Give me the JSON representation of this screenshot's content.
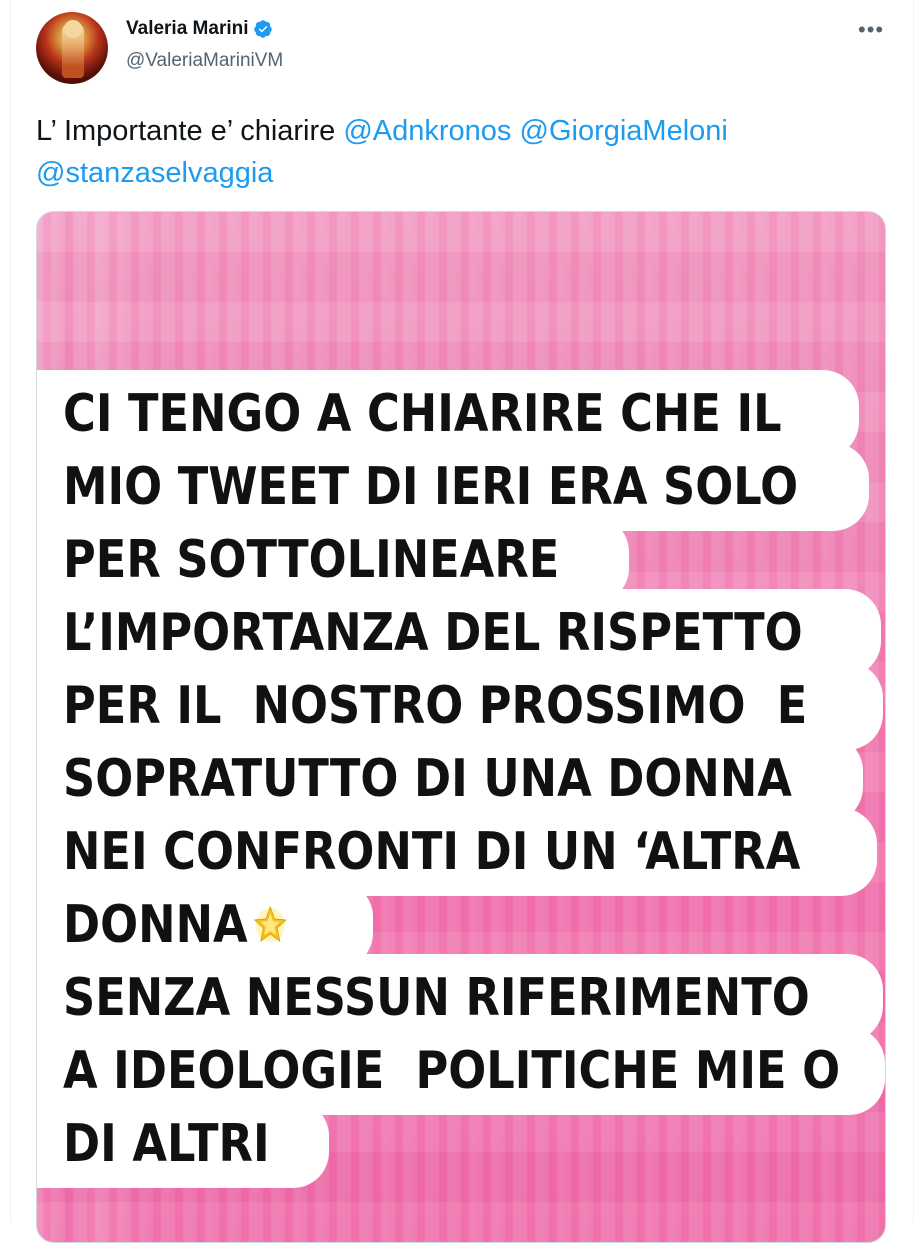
{
  "author": {
    "display_name": "Valeria Marini",
    "handle": "@ValeriaMariniVM",
    "verified": true,
    "avatar_icon": "profile-photo-icon"
  },
  "actions": {
    "more_label": "•••"
  },
  "tweet": {
    "text_prefix": "L’ Importante e’ chiarire ",
    "mentions": [
      "@Adnkronos",
      "@GiorgiaMeloni",
      "@stanzaselvaggia"
    ]
  },
  "media": {
    "lines": [
      "CI TENGO A CHIARIRE CHE IL",
      "MIO TWEET DI IERI ERA SOLO",
      "PER SOTTOLINEARE",
      "L’IMPORTANZA DEL RISPETTO",
      "PER IL  NOSTRO PROSSIMO  E",
      "SOPRATUTTO DI UNA DONNA",
      "NEI CONFRONTI DI UN ‘ALTRA",
      "DONNA",
      "SENZA NESSUN RIFERIMENTO",
      "A IDEOLOGIE  POLITICHE MIE O",
      "DI ALTRI"
    ],
    "star_icon": "glowing-star-emoji-icon",
    "background_color": "#f07ab3"
  },
  "colors": {
    "mention": "#1d9bf0",
    "secondary_text": "#536471",
    "primary_text": "#0f1419",
    "verified_badge": "#1d9bf0"
  }
}
